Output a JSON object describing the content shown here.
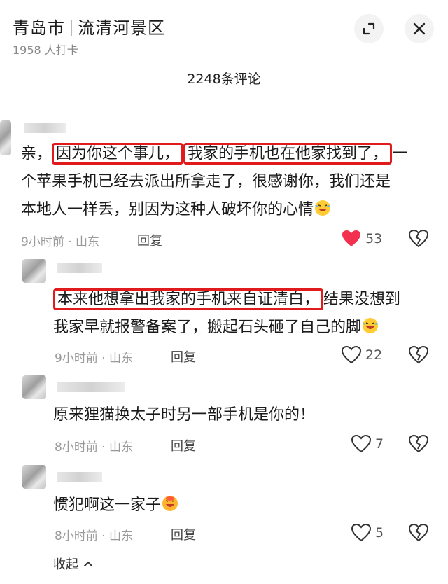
{
  "header": {
    "city": "青岛市",
    "place": "流清河景区",
    "checkins": "1958 人打卡"
  },
  "comments_count": "2248条评论",
  "comments": [
    {
      "lines": [
        [
          {
            "t": "亲，",
            "hl": false
          },
          {
            "t": "因为你这个事儿，",
            "hl": true
          },
          {
            "t": "我家的手机也在他家找到了，",
            "hl": true
          },
          {
            "t": "一",
            "hl": false
          }
        ],
        [
          {
            "t": "个苹果手机已经去派出所拿走了，很感谢你，我们还是",
            "hl": false
          }
        ],
        [
          {
            "t": "本地人一样丢，别因为这种人破坏你的心情",
            "hl": false
          }
        ]
      ],
      "emoji": "laugh-cry",
      "meta": "9小时前 · 山东",
      "reply": "回复",
      "likes": "53",
      "liked": true
    },
    {
      "lines": [
        [
          {
            "t": "本来他想拿出我家的手机来自证清白，",
            "hl": true
          },
          {
            "t": "结果没想到",
            "hl": false
          }
        ],
        [
          {
            "t": "我家早就报警备案了，搬起石头砸了自己的脚",
            "hl": false
          }
        ]
      ],
      "emoji": "laugh-cry",
      "meta": "9小时前 · 山东",
      "reply": "回复",
      "likes": "22",
      "liked": false
    },
    {
      "lines": [
        [
          {
            "t": "原来狸猫换太子时另一部手机是你的！",
            "hl": false
          }
        ]
      ],
      "emoji": "",
      "meta": "8小时前 · 山东",
      "reply": "回复",
      "likes": "7",
      "liked": false
    },
    {
      "lines": [
        [
          {
            "t": "惯犯啊这一家子",
            "hl": false
          }
        ]
      ],
      "emoji": "grin",
      "meta": "8小时前 · 山东",
      "reply": "回复",
      "likes": "5",
      "liked": false
    }
  ],
  "collapse_label": "收起",
  "colors": {
    "like_active": "#f2304f",
    "highlight_border": "#e11b1b"
  }
}
